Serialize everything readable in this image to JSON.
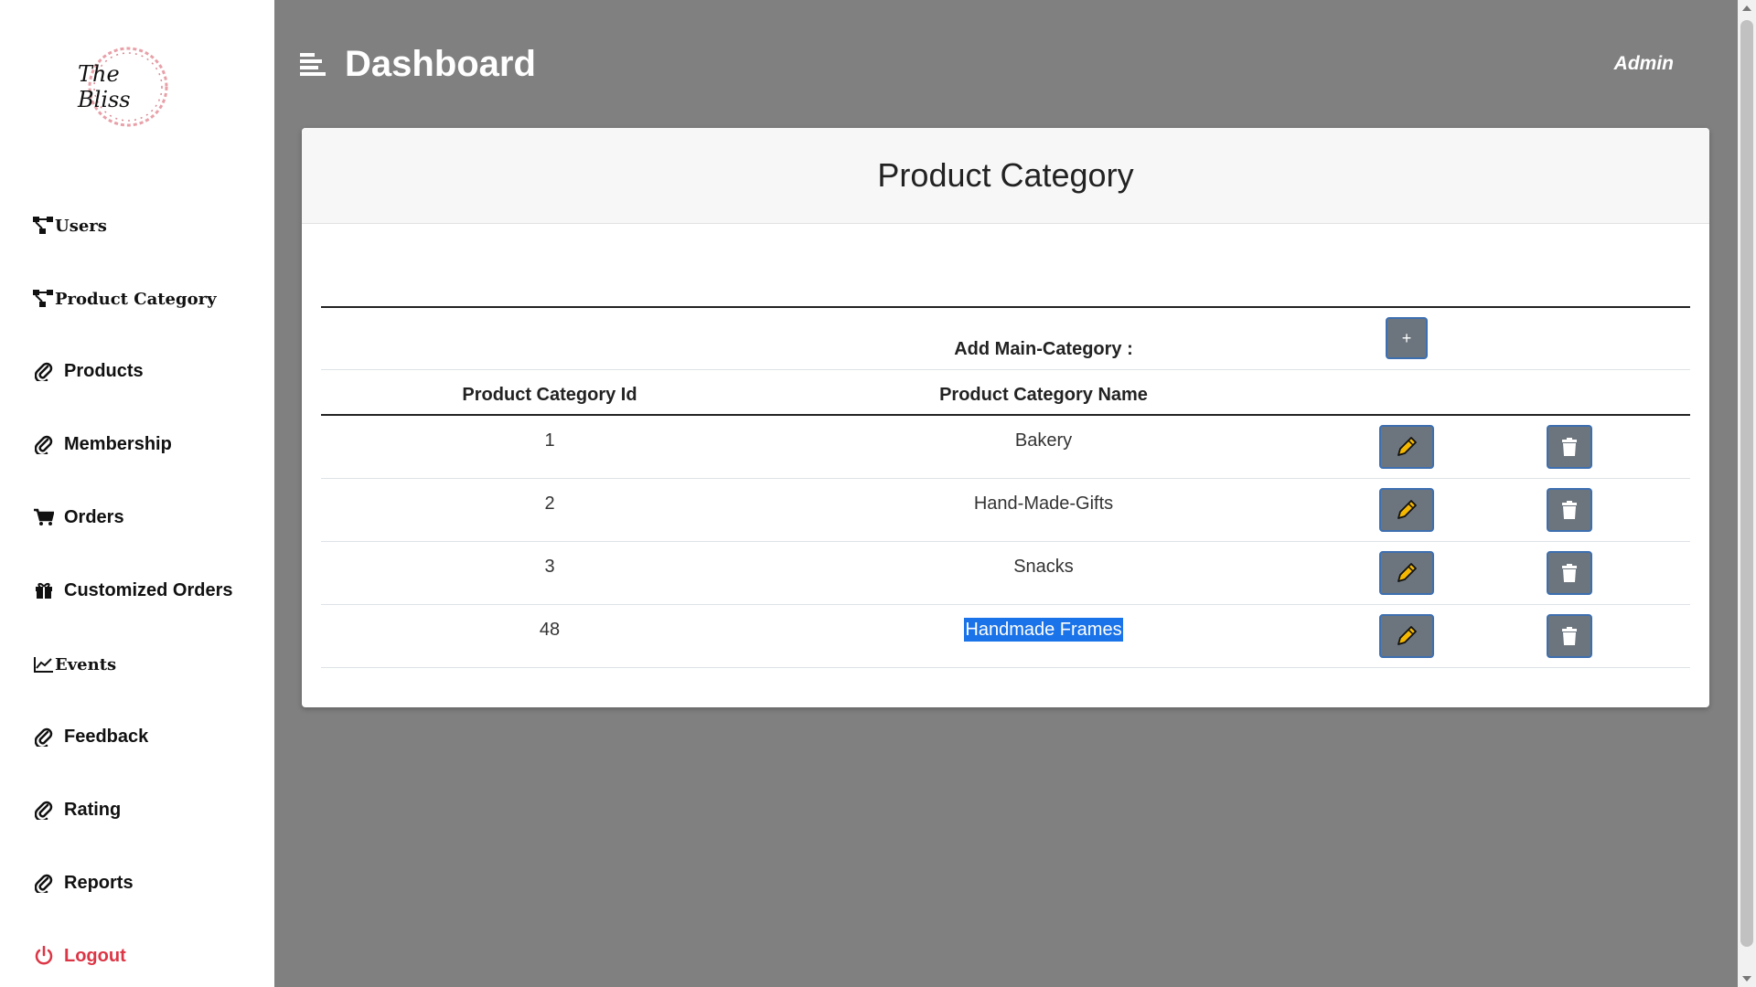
{
  "logo": {
    "text": "The Bliss"
  },
  "sidebar": {
    "items": [
      {
        "label": "Users",
        "icon": "sitemap-icon"
      },
      {
        "label": "Product Category",
        "icon": "sitemap-icon"
      },
      {
        "label": "Products",
        "icon": "paperclip-icon"
      },
      {
        "label": "Membership",
        "icon": "paperclip-icon"
      },
      {
        "label": "Orders",
        "icon": "cart-icon"
      },
      {
        "label": "Customized Orders",
        "icon": "gift-icon"
      },
      {
        "label": "Events",
        "icon": "line-chart-icon"
      },
      {
        "label": "Feedback",
        "icon": "paperclip-icon"
      },
      {
        "label": "Rating",
        "icon": "paperclip-icon"
      },
      {
        "label": "Reports",
        "icon": "paperclip-icon"
      },
      {
        "label": "Logout",
        "icon": "power-icon"
      }
    ]
  },
  "header": {
    "title": "Dashboard",
    "user": "Admin"
  },
  "card": {
    "title": "Product Category",
    "add_label": "Add Main-Category :",
    "add_button": "+",
    "columns": [
      "Product Category Id",
      "Product Category Name"
    ],
    "rows": [
      {
        "id": "1",
        "name": "Bakery"
      },
      {
        "id": "2",
        "name": "Hand-Made-Gifts"
      },
      {
        "id": "3",
        "name": "Snacks"
      },
      {
        "id": "48",
        "name": "Handmade Frames"
      }
    ]
  },
  "colors": {
    "accent_border": "#3d6fb0",
    "button_bg": "#6c757d",
    "logout": "#dc3545",
    "page_bg": "#808080",
    "selection": "#1a73e8"
  }
}
